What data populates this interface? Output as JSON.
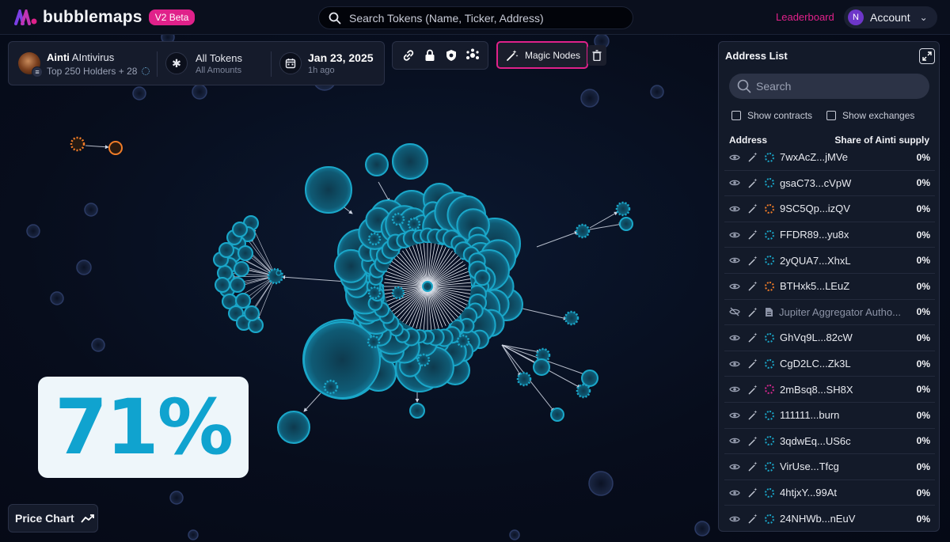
{
  "app": {
    "brand": "bubblemaps",
    "badge": "V2 Beta",
    "search_placeholder": "Search Tokens (Name, Ticker, Address)",
    "leaderboard": "Leaderboard",
    "account_initial": "N",
    "account_label": "Account"
  },
  "token": {
    "symbol": "Ainti",
    "name": "AIntivirus",
    "holders_label": "Top 250 Holders + 28",
    "tokens_label": "All Tokens",
    "amounts_label": "All Amounts",
    "date_label": "Jan 23, 2025",
    "ago_label": "1h ago"
  },
  "toolbar": {
    "icons": [
      "link-icon",
      "lock-icon",
      "shield-icon",
      "network-icon"
    ],
    "magic_label": "Magic Nodes"
  },
  "overlay": {
    "percent": "71%",
    "price_chart_label": "Price Chart"
  },
  "address_list": {
    "title": "Address List",
    "search_placeholder": "Search",
    "show_contracts": "Show contracts",
    "show_exchanges": "Show exchanges",
    "col_address": "Address",
    "col_share": "Share of Ainti supply",
    "rows": [
      {
        "address": "7wxAcZ...jMVe",
        "share": "0%",
        "dot": "#1aa7c9",
        "hidden": false
      },
      {
        "address": "gsaC73...cVpW",
        "share": "0%",
        "dot": "#1aa7c9",
        "hidden": false
      },
      {
        "address": "9SC5Qp...izQV",
        "share": "0%",
        "dot": "#f07c28",
        "hidden": false
      },
      {
        "address": "FFDR89...yu8x",
        "share": "0%",
        "dot": "#1aa7c9",
        "hidden": false
      },
      {
        "address": "2yQUA7...XhxL",
        "share": "0%",
        "dot": "#1aa7c9",
        "hidden": false
      },
      {
        "address": "BTHxk5...LEuZ",
        "share": "0%",
        "dot": "#f07c28",
        "hidden": false
      },
      {
        "address": "Jupiter Aggregator Autho...",
        "share": "0%",
        "dot": "",
        "hidden": true
      },
      {
        "address": "GhVq9L...82cW",
        "share": "0%",
        "dot": "#1aa7c9",
        "hidden": false
      },
      {
        "address": "CgD2LC...Zk3L",
        "share": "0%",
        "dot": "#1aa7c9",
        "hidden": false
      },
      {
        "address": "2mBsq8...SH8X",
        "share": "0%",
        "dot": "#d4278e",
        "hidden": false
      },
      {
        "address": "111111...burn",
        "share": "0%",
        "dot": "#1aa7c9",
        "hidden": false
      },
      {
        "address": "3qdwEq...US6c",
        "share": "0%",
        "dot": "#1aa7c9",
        "hidden": false
      },
      {
        "address": "VirUse...Tfcg",
        "share": "0%",
        "dot": "#1aa7c9",
        "hidden": false
      },
      {
        "address": "4htjxY...99At",
        "share": "0%",
        "dot": "#1aa7c9",
        "hidden": false
      },
      {
        "address": "24NHWb...nEuV",
        "share": "0%",
        "dot": "#1aa7c9",
        "hidden": false
      }
    ]
  },
  "colors": {
    "accent": "#e0218a",
    "bubble": "#1aa7c9",
    "bubble_dark": "#0d4b62",
    "orange": "#f07c28"
  }
}
